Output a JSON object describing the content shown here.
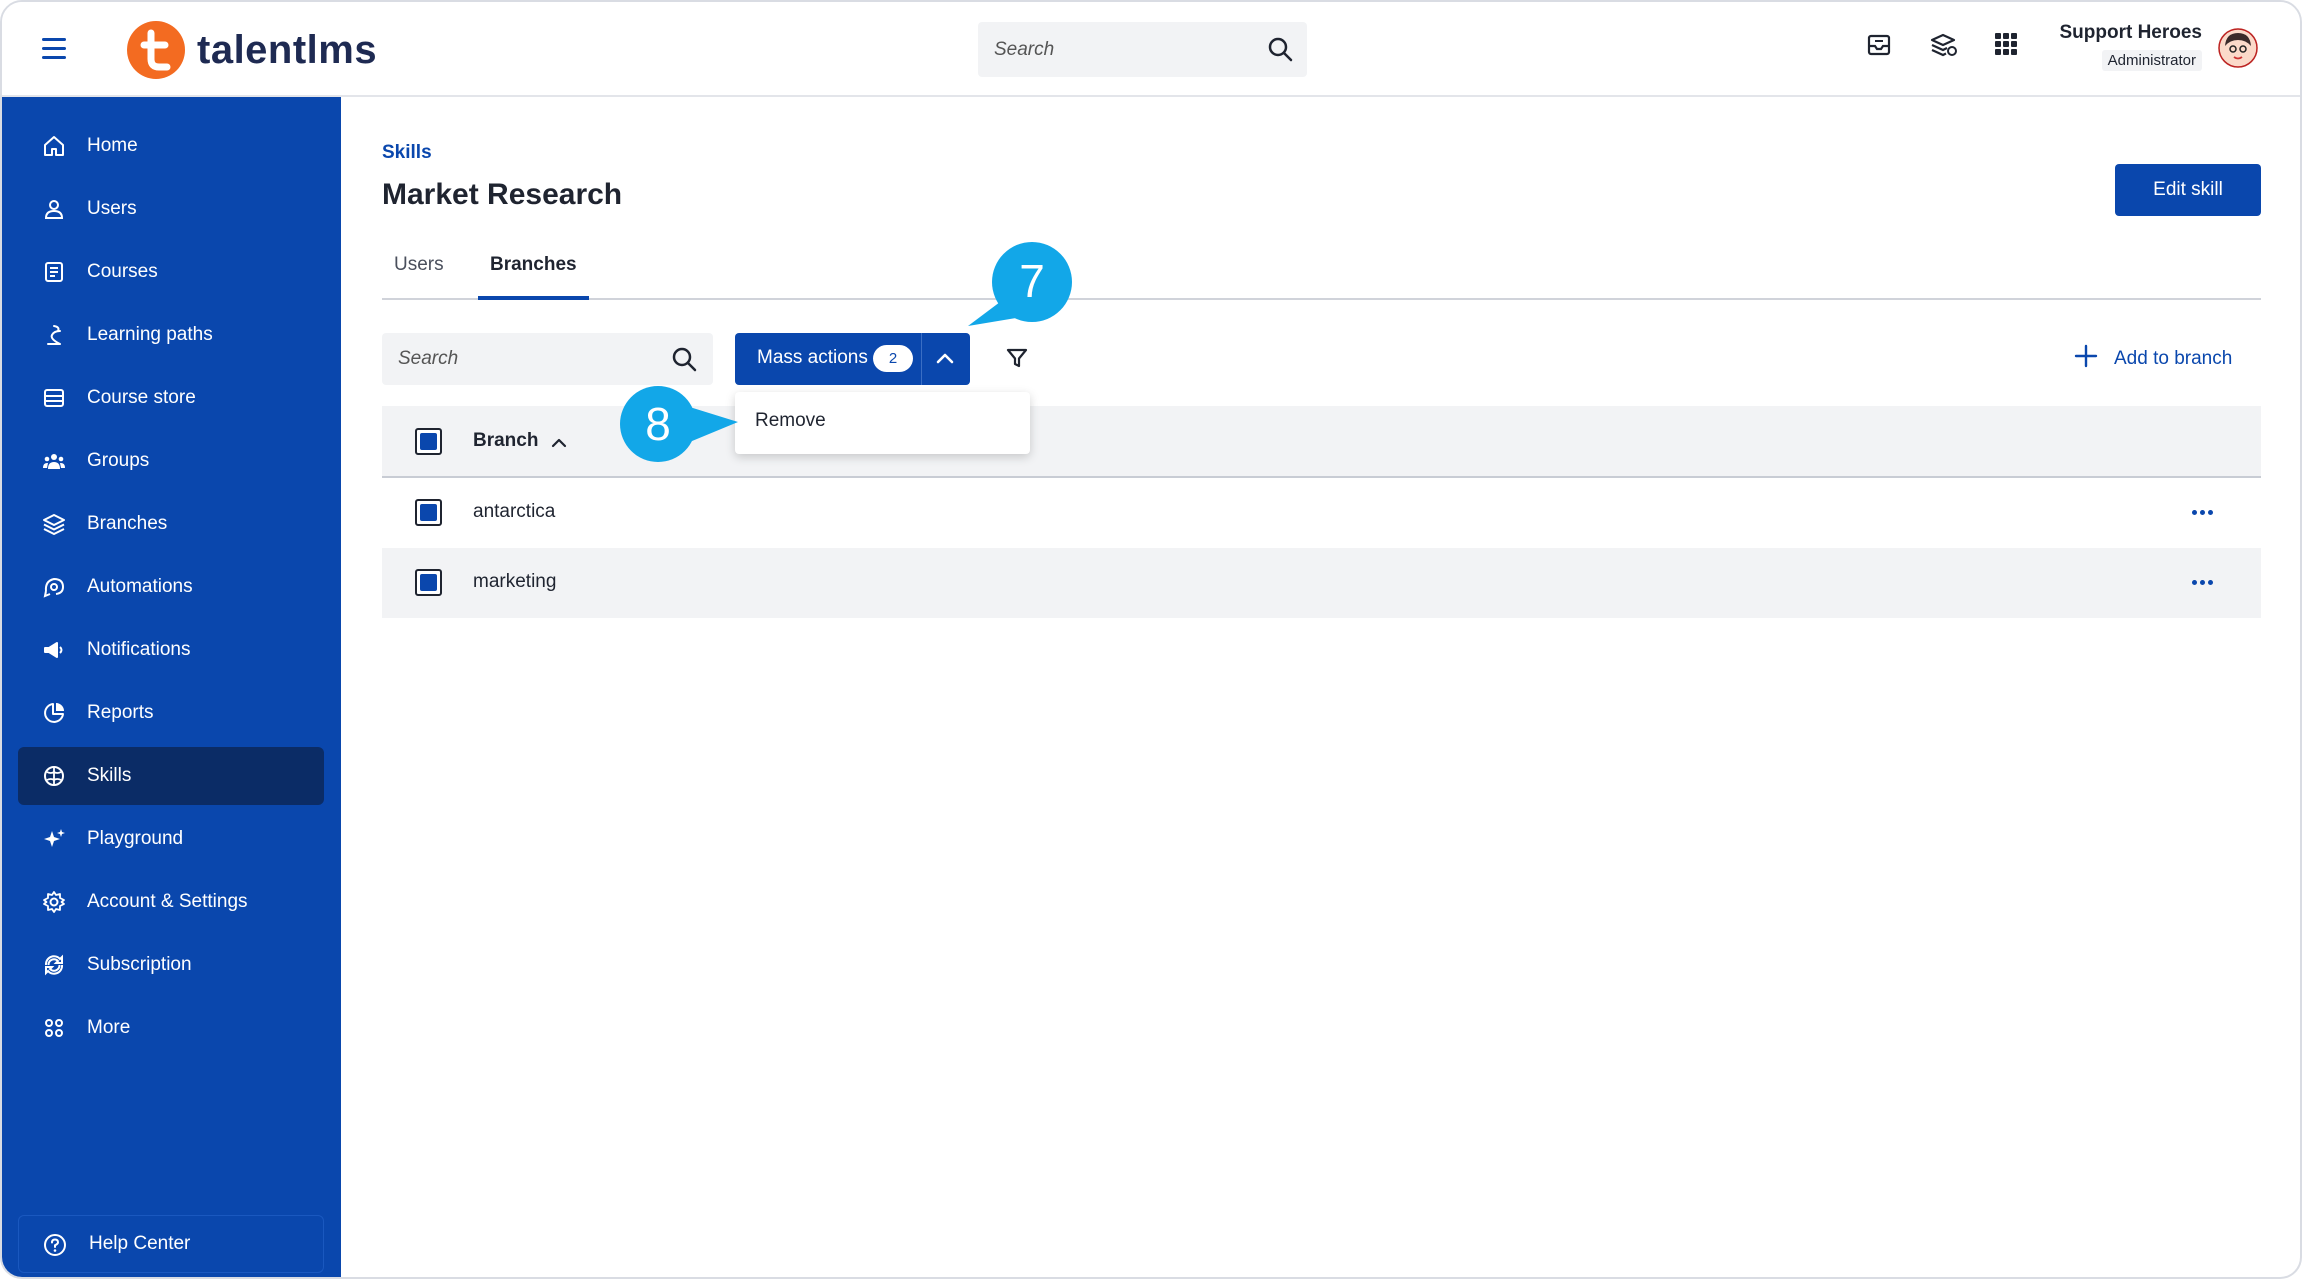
{
  "app": {
    "brand": "talentlms",
    "accent": "#0a47ad",
    "sidebar_bg": "#0a47ad",
    "sidebar_active_bg": "#0b2c66",
    "logo_color": "#f36b21",
    "callout_color": "#12a7e8"
  },
  "topbar": {
    "search_placeholder": "Search",
    "icons": [
      "inbox-icon",
      "layers-settings-icon",
      "apps-grid-icon"
    ],
    "user_name": "Support Heroes",
    "user_role": "Administrator"
  },
  "sidebar": {
    "items": [
      {
        "label": "Home",
        "icon": "home-icon"
      },
      {
        "label": "Users",
        "icon": "user-icon"
      },
      {
        "label": "Courses",
        "icon": "book-icon"
      },
      {
        "label": "Learning paths",
        "icon": "path-icon"
      },
      {
        "label": "Course store",
        "icon": "store-icon"
      },
      {
        "label": "Groups",
        "icon": "group-icon"
      },
      {
        "label": "Branches",
        "icon": "layers-icon"
      },
      {
        "label": "Automations",
        "icon": "automation-icon"
      },
      {
        "label": "Notifications",
        "icon": "megaphone-icon"
      },
      {
        "label": "Reports",
        "icon": "pie-chart-icon"
      },
      {
        "label": "Skills",
        "icon": "brain-icon",
        "active": true
      },
      {
        "label": "Playground",
        "icon": "sparkle-icon"
      },
      {
        "label": "Account & Settings",
        "icon": "gear-icon"
      },
      {
        "label": "Subscription",
        "icon": "subscription-icon"
      },
      {
        "label": "More",
        "icon": "more-grid-icon"
      }
    ],
    "help_label": "Help Center"
  },
  "main": {
    "breadcrumb": "Skills",
    "title": "Market Research",
    "edit_button": "Edit skill",
    "tabs": [
      {
        "label": "Users"
      },
      {
        "label": "Branches",
        "active": true
      }
    ],
    "search_placeholder": "Search",
    "mass_actions": {
      "label": "Mass actions",
      "count": "2"
    },
    "add_branch": "Add to branch",
    "dropdown": {
      "items": [
        "Remove"
      ]
    },
    "table": {
      "header": "Branch",
      "rows": [
        {
          "name": "antarctica"
        },
        {
          "name": "marketing"
        }
      ]
    }
  },
  "callouts": {
    "step_a": "7",
    "step_b": "8"
  }
}
